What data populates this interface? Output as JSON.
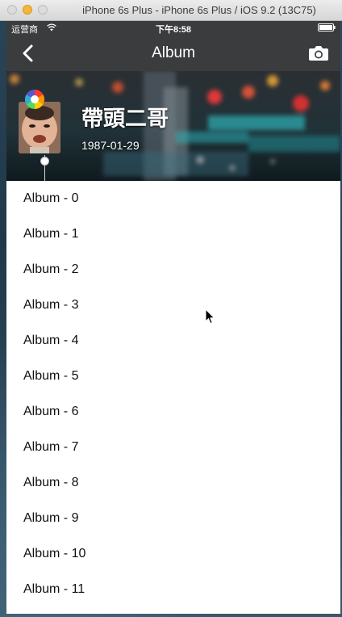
{
  "window": {
    "title": "iPhone 6s Plus - iPhone 6s Plus / iOS 9.2 (13C75)"
  },
  "status_bar": {
    "carrier": "运营商",
    "time": "下午8:58",
    "icons": [
      "wifi-icon",
      "battery-icon"
    ]
  },
  "navbar": {
    "title": "Album",
    "left_icon": "chevron-left-icon",
    "right_icon": "camera-icon",
    "background": "#3b3c3e"
  },
  "profile": {
    "name": "帶頭二哥",
    "birthday": "1987-01-29"
  },
  "albums": [
    {
      "label": "Album - 0"
    },
    {
      "label": "Album - 1"
    },
    {
      "label": "Album - 2"
    },
    {
      "label": "Album - 3"
    },
    {
      "label": "Album - 4"
    },
    {
      "label": "Album - 5"
    },
    {
      "label": "Album - 6"
    },
    {
      "label": "Album - 7"
    },
    {
      "label": "Album - 8"
    },
    {
      "label": "Album - 9"
    },
    {
      "label": "Album - 10"
    },
    {
      "label": "Album - 11"
    }
  ]
}
